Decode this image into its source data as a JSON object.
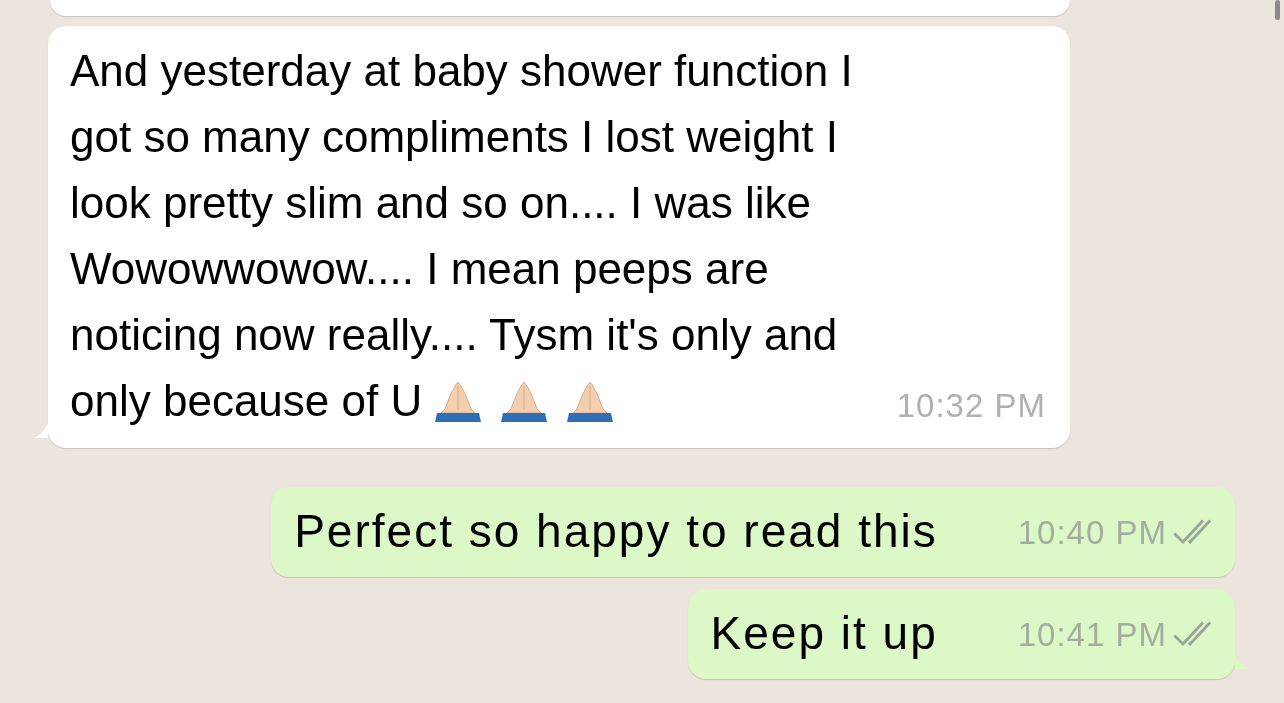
{
  "messages": [
    {
      "kind": "partial-incoming"
    },
    {
      "kind": "incoming",
      "text": "And yesterday at baby shower function I\ngot so many compliments I lost weight I\nlook pretty slim and so on.... I was like\nWowowwowow.... I mean peeps are\nnoticing now really.... Tysm it's only and\nonly because of U",
      "emojis": [
        {
          "kind": "praying-hands"
        },
        {
          "kind": "praying-hands"
        },
        {
          "kind": "praying-hands"
        }
      ],
      "time": "10:32 PM",
      "tail": true
    },
    {
      "kind": "outgoing",
      "text": "Perfect so happy to read this",
      "time": "10:40 PM",
      "read": false,
      "tail": false
    },
    {
      "kind": "outgoing",
      "text": "Keep it up",
      "time": "10:41 PM",
      "read": false,
      "tail": true
    }
  ]
}
